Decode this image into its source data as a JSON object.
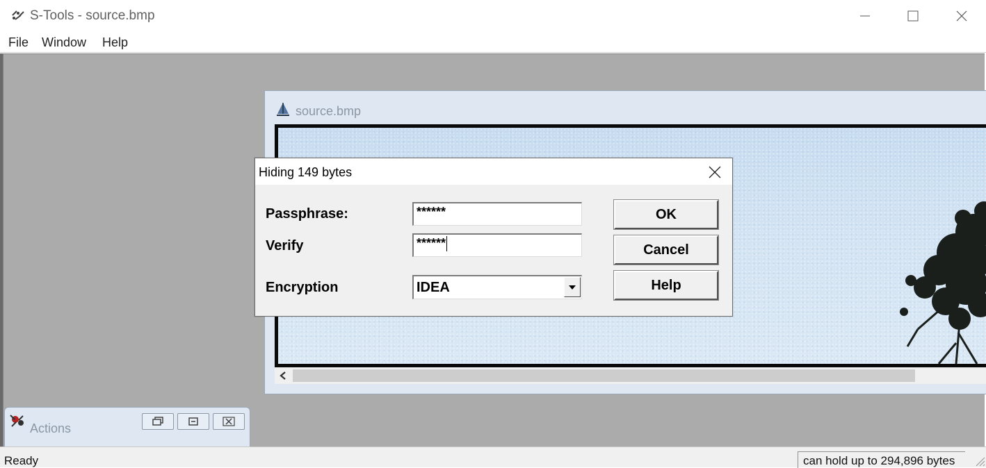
{
  "window": {
    "title": "S-Tools - source.bmp",
    "icon": "stools-app-icon"
  },
  "menu": {
    "items": [
      {
        "label": "File"
      },
      {
        "label": "Window"
      },
      {
        "label": "Help"
      }
    ]
  },
  "child_window": {
    "title": "source.bmp",
    "icon": "bmp-document-icon"
  },
  "dialog": {
    "title": "Hiding 149 bytes",
    "passphrase_label": "Passphrase:",
    "passphrase_value": "******",
    "verify_label": "Verify",
    "verify_value": "******",
    "encryption_label": "Encryption",
    "encryption_value": "IDEA",
    "ok_label": "OK",
    "cancel_label": "Cancel",
    "help_label": "Help"
  },
  "actions_window": {
    "title": "Actions",
    "icon": "actions-icon"
  },
  "status": {
    "left": "Ready",
    "right": "can hold up to 294,896 bytes"
  }
}
